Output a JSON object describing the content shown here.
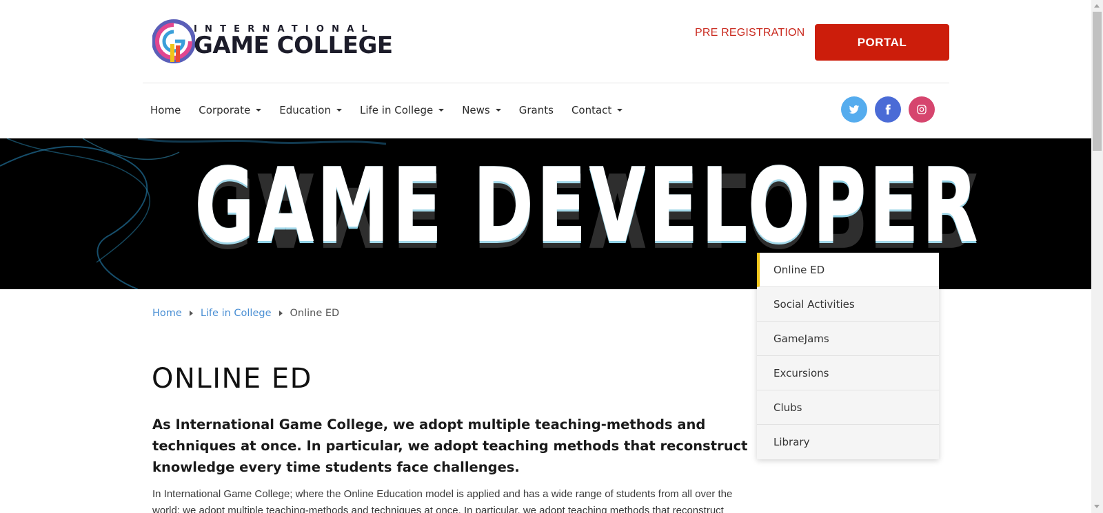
{
  "header": {
    "logo_top": "INTERNATIONAL",
    "logo_main": "GAME COLLEGE",
    "pre_registration": "PRE REGISTRATION",
    "portal": "PORTAL"
  },
  "nav": {
    "items": [
      {
        "label": "Home",
        "dropdown": false
      },
      {
        "label": "Corporate",
        "dropdown": true
      },
      {
        "label": "Education",
        "dropdown": true
      },
      {
        "label": "Life in College",
        "dropdown": true
      },
      {
        "label": "News",
        "dropdown": true
      },
      {
        "label": "Grants",
        "dropdown": false
      },
      {
        "label": "Contact",
        "dropdown": true
      }
    ],
    "social": [
      {
        "name": "twitter-icon",
        "color": "#55acee"
      },
      {
        "name": "facebook-icon",
        "color": "#4a6bd6"
      },
      {
        "name": "instagram-icon",
        "color": "#d6456e"
      }
    ]
  },
  "banner": {
    "title": "GAME DEVELOPER"
  },
  "breadcrumb": {
    "items": [
      "Home",
      "Life in College"
    ],
    "current": "Online ED"
  },
  "content": {
    "title": "ONLINE ED",
    "lead": "As International Game College, we adopt multiple teaching-methods and techniques at once. In particular, we adopt teaching methods that reconstruct knowledge every time students face challenges.",
    "body": "In International Game College; where the Online Education model is applied and has a wide range of students from all over the world; we adopt multiple teaching-methods and techniques at once. In particular, we adopt teaching methods that reconstruct"
  },
  "side_menu": {
    "active_index": 0,
    "accent_color": "#f0c419",
    "items": [
      "Online ED",
      "Social Activities",
      "GameJams",
      "Excursions",
      "Clubs",
      "Library"
    ]
  },
  "colors": {
    "portal_button": "#cc1d0b",
    "pre_registration": "#c9281d",
    "breadcrumb_link": "#4a8fd4"
  }
}
